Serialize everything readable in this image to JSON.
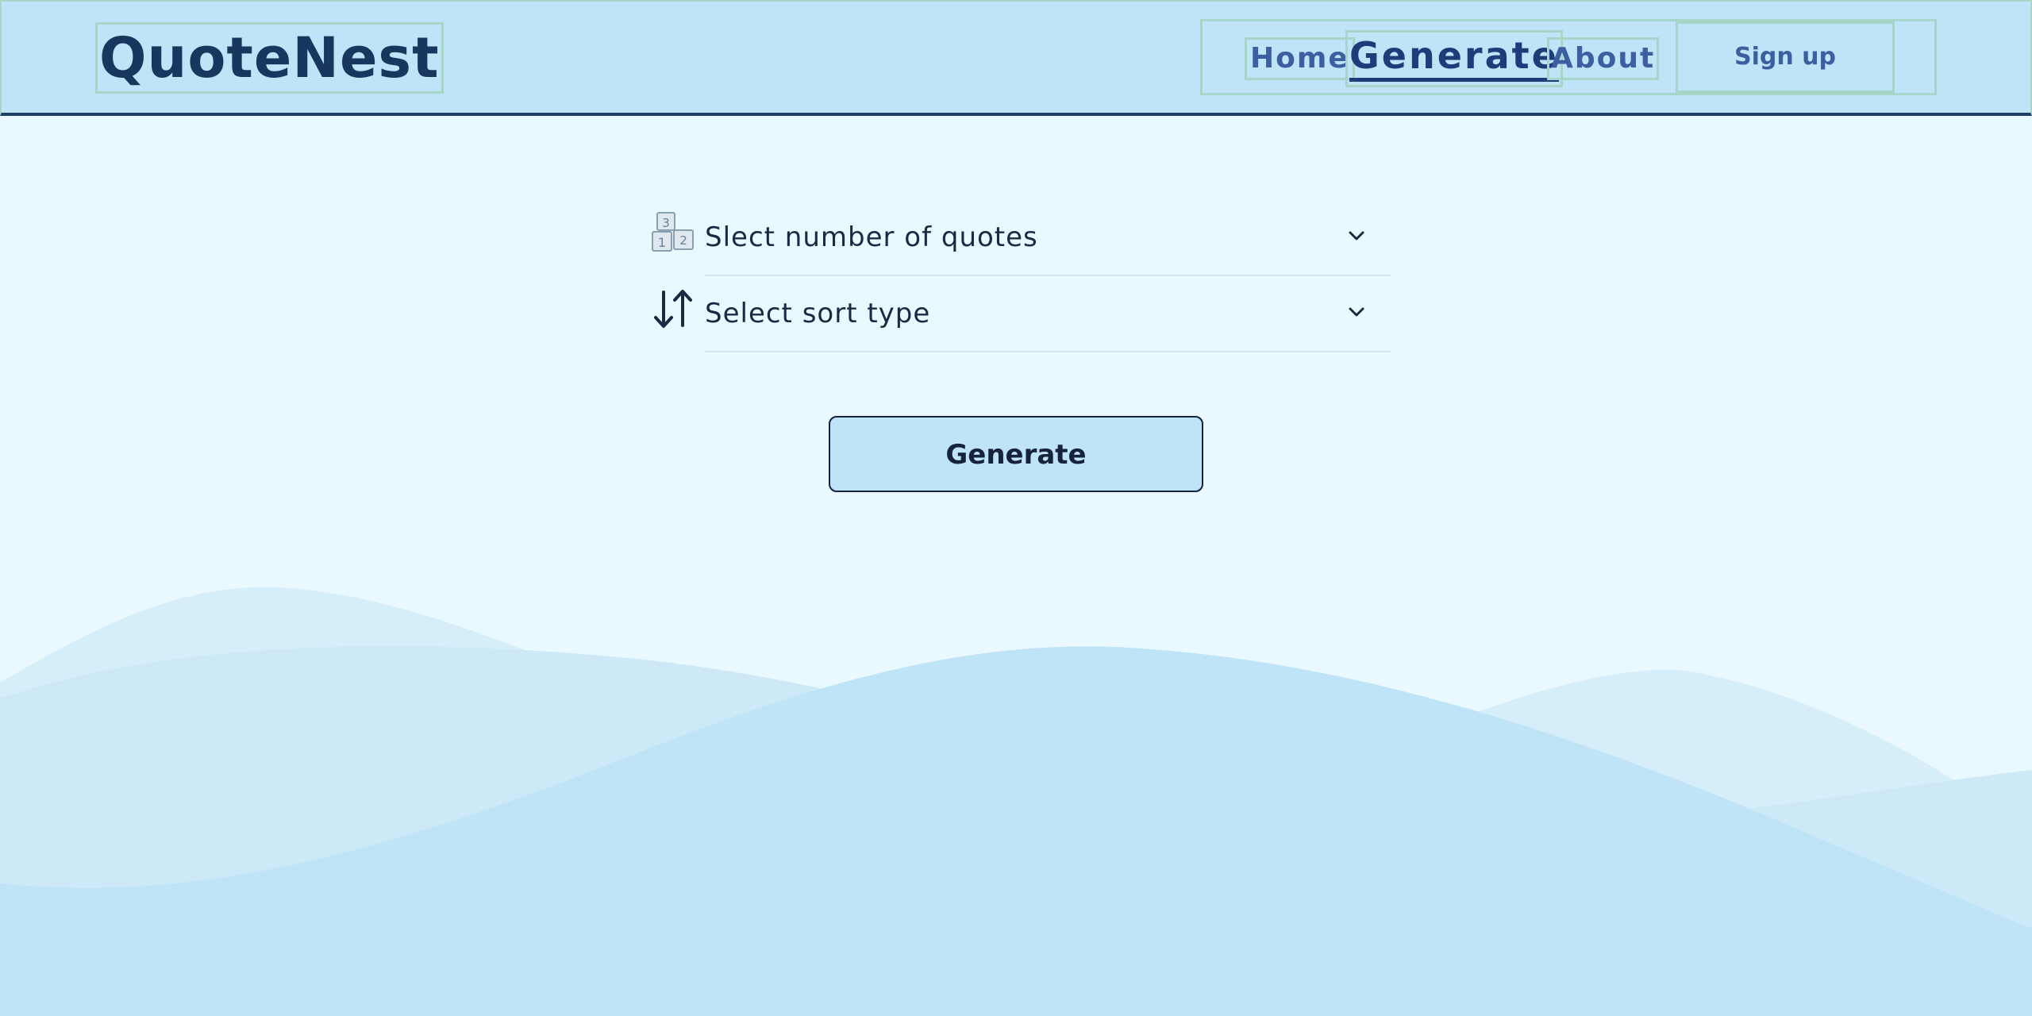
{
  "header": {
    "logo": "QuoteNest",
    "nav": {
      "home": "Home",
      "generate": "Generate",
      "about": "About"
    },
    "signup": "Sign up"
  },
  "form": {
    "quote_count_select": {
      "label": "Slect number of quotes",
      "icon": "number-blocks-icon"
    },
    "sort_select": {
      "label": "Select sort type",
      "icon": "sort-arrows-icon"
    },
    "generate_button": "Generate"
  },
  "colors": {
    "header_bg": "#bfe3f7",
    "page_bg": "#eaf8ff",
    "accent_dark": "#17375e",
    "nav_text": "#3b5fa0",
    "wave_main": "#bfe3f7",
    "wave_light": "#d6eef9"
  }
}
